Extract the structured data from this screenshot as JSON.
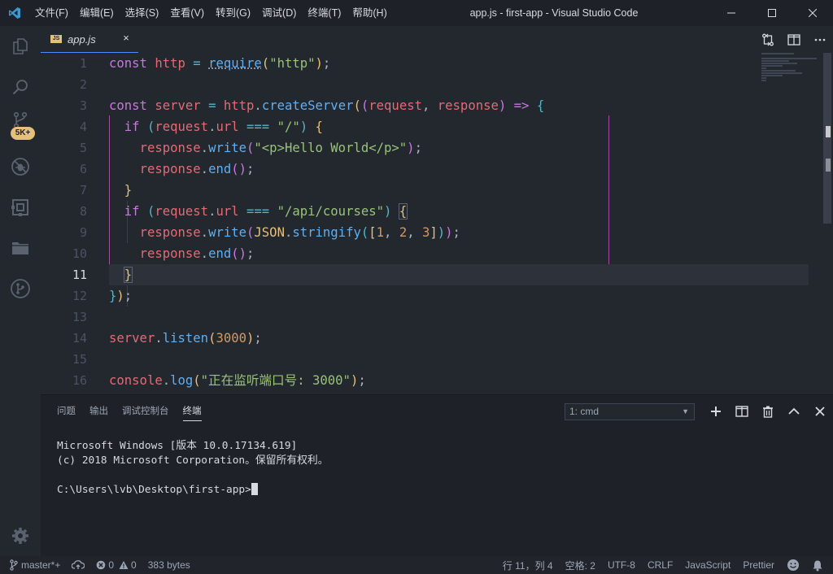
{
  "titlebar": {
    "menu": [
      "文件(F)",
      "编辑(E)",
      "选择(S)",
      "查看(V)",
      "转到(G)",
      "调试(D)",
      "终端(T)",
      "帮助(H)"
    ],
    "title": "app.js - first-app - Visual Studio Code"
  },
  "activitybar": {
    "items": [
      "explorer-icon",
      "search-icon",
      "source-control-icon",
      "debug-icon",
      "extensions-icon",
      "folder-icon",
      "git-graph-icon"
    ],
    "scm_badge": "5K+",
    "settings_icon": "gear-icon"
  },
  "tab": {
    "icon_text": "JS",
    "label": "app.js",
    "close": "×"
  },
  "editor": {
    "line_numbers": [
      "1",
      "2",
      "3",
      "4",
      "5",
      "6",
      "7",
      "8",
      "9",
      "10",
      "11",
      "12",
      "13",
      "14",
      "15",
      "16"
    ],
    "active_line": 11
  },
  "panel": {
    "tabs": [
      "问题",
      "输出",
      "调试控制台",
      "终端"
    ],
    "active_tab": "终端",
    "terminal_select": "1: cmd",
    "terminal_lines": [
      "Microsoft Windows [版本 10.0.17134.619]",
      "(c) 2018 Microsoft Corporation。保留所有权利。",
      "",
      "C:\\Users\\lvb\\Desktop\\first-app>"
    ]
  },
  "statusbar": {
    "branch": "master*+",
    "errors": "0",
    "warnings": "0",
    "filesize": "383 bytes",
    "position": "行 11，列 4",
    "indent": "空格: 2",
    "encoding": "UTF-8",
    "eol": "CRLF",
    "language": "JavaScript",
    "formatter": "Prettier"
  },
  "colors": {
    "accent": "#528bff",
    "badge": "#e5c07b",
    "scope_box": "#a34aa3"
  }
}
